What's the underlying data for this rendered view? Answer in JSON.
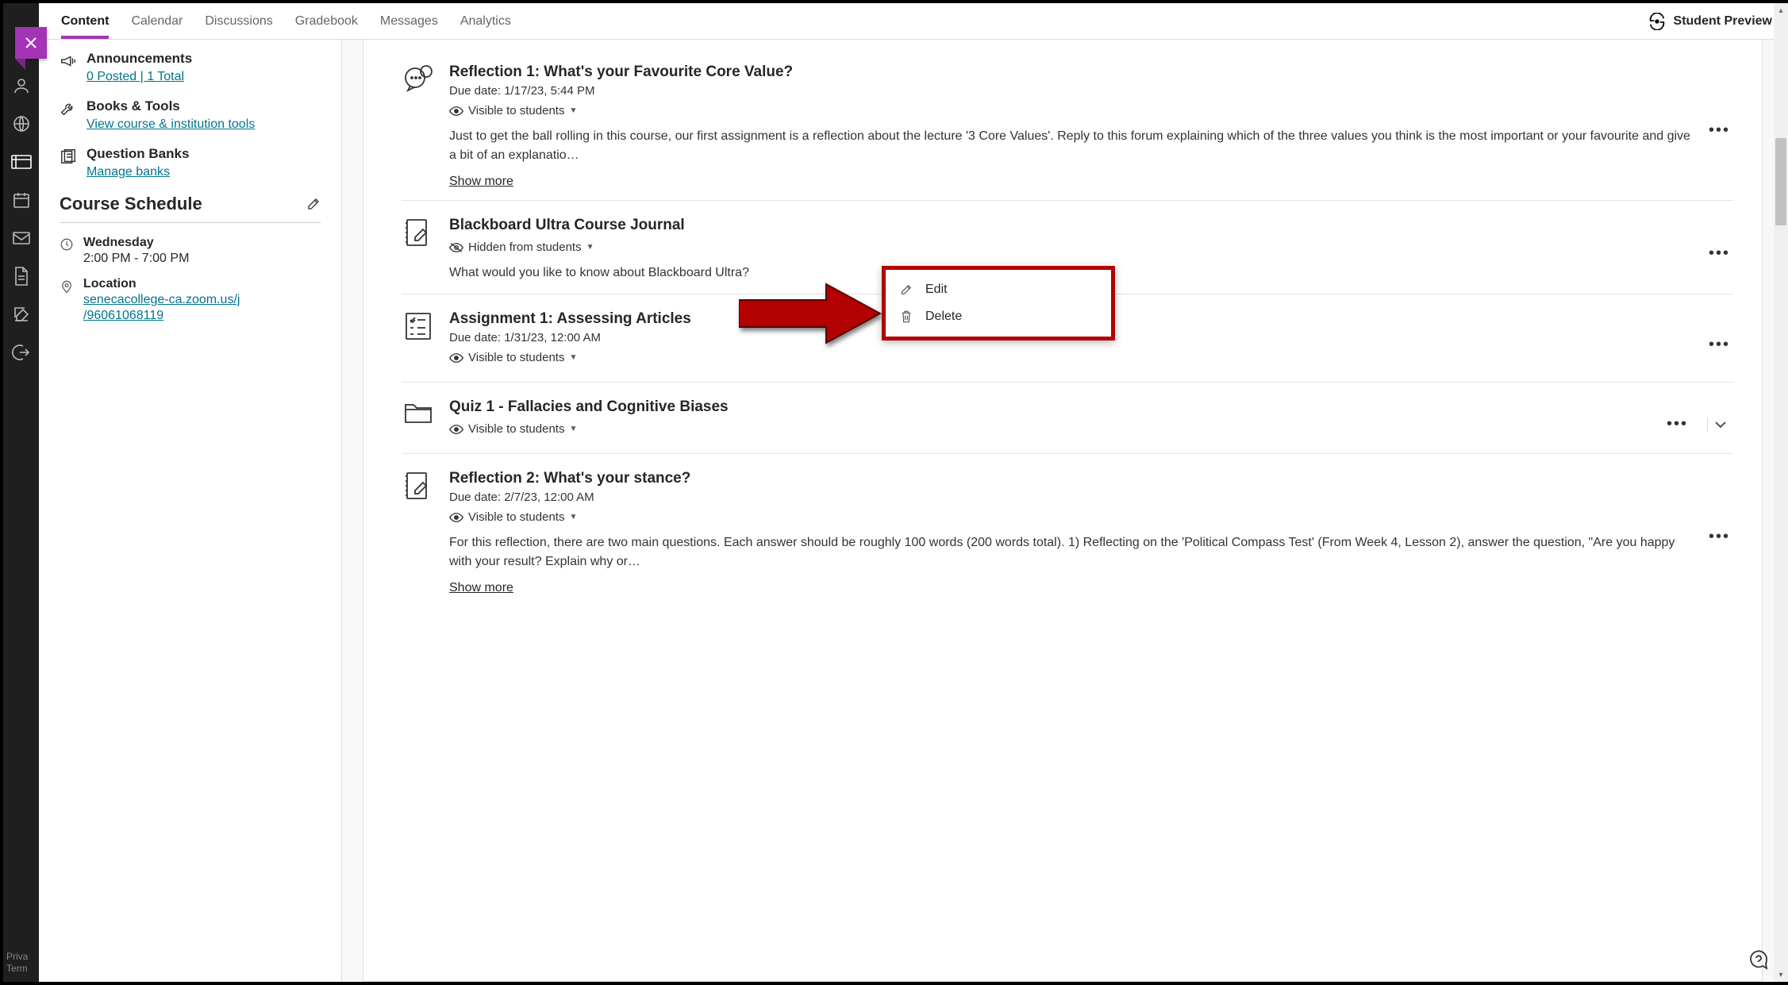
{
  "topbar": {
    "tabs": [
      "Content",
      "Calendar",
      "Discussions",
      "Gradebook",
      "Messages",
      "Analytics"
    ],
    "active_tab_index": 0,
    "student_preview": "Student Preview"
  },
  "rail_footer": {
    "line1": "Priva",
    "line2": "Term"
  },
  "sidepanel": {
    "announcements": {
      "title": "Announcements",
      "link": "0 Posted  |  1 Total"
    },
    "books": {
      "title": "Books & Tools",
      "link": "View course & institution tools"
    },
    "qbanks": {
      "title": "Question Banks",
      "link": "Manage banks"
    },
    "schedule_header": "Course Schedule",
    "schedule_day_label": "Wednesday",
    "schedule_time": "2:00 PM - 7:00 PM",
    "location_label": "Location",
    "location_link1": "senecacollege-ca.zoom.us/j",
    "location_link2": "/96061068119"
  },
  "visibility_labels": {
    "visible": "Visible to students",
    "hidden": "Hidden from students"
  },
  "items": [
    {
      "title": "Reflection 1: What's your Favourite Core Value?",
      "due": "Due date: 1/17/23, 5:44 PM",
      "visibility": "visible",
      "desc": "Just to get the ball rolling in this course, our first assignment is a reflection about the lecture '3 Core Values'. Reply to this forum explaining which of the three values you think is the most important or your favourite and give a bit of an explanatio…",
      "show_more": "Show more"
    },
    {
      "title": "Blackboard Ultra Course Journal",
      "visibility": "hidden",
      "desc": "What would you like to know about Blackboard Ultra?"
    },
    {
      "title": "Assignment 1: Assessing Articles",
      "due": "Due date: 1/31/23, 12:00 AM",
      "visibility": "visible"
    },
    {
      "title": "Quiz 1 - Fallacies and Cognitive Biases",
      "visibility": "visible",
      "expandable": true
    },
    {
      "title": "Reflection 2: What's your stance?",
      "due": "Due date: 2/7/23, 12:00 AM",
      "visibility": "visible",
      "desc": "For this reflection, there are two main questions. Each answer should be roughly 100 words (200 words total). 1) Reflecting on the 'Political Compass Test' (From Week 4, Lesson 2), answer the question, \"Are you happy with your result? Explain why or…",
      "show_more": "Show more"
    }
  ],
  "ctx_menu": {
    "edit": "Edit",
    "delete": "Delete"
  }
}
